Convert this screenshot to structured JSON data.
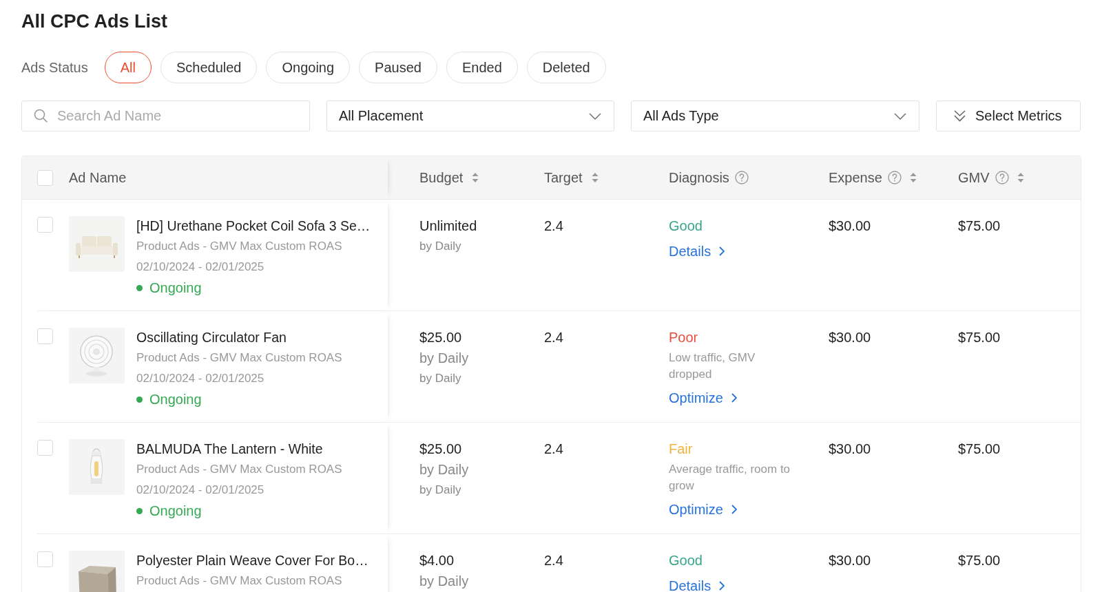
{
  "page": {
    "title": "All CPC Ads List"
  },
  "status_filter": {
    "label": "Ads Status",
    "options": [
      {
        "label": "All",
        "selected": true
      },
      {
        "label": "Scheduled",
        "selected": false
      },
      {
        "label": "Ongoing",
        "selected": false
      },
      {
        "label": "Paused",
        "selected": false
      },
      {
        "label": "Ended",
        "selected": false
      },
      {
        "label": "Deleted",
        "selected": false
      }
    ]
  },
  "filters": {
    "search": {
      "placeholder": "Search Ad Name"
    },
    "placement": {
      "value": "All Placement"
    },
    "ads_type": {
      "value": "All Ads Type"
    },
    "metrics_button": {
      "label": "Select Metrics"
    }
  },
  "table": {
    "select_all": {
      "checked": false
    },
    "columns": [
      {
        "label": "Ad Name",
        "help": false,
        "sortable": false
      },
      {
        "label": "Budget",
        "help": false,
        "sortable": true
      },
      {
        "label": "Target",
        "help": false,
        "sortable": true
      },
      {
        "label": "Diagnosis",
        "help": true,
        "sortable": false
      },
      {
        "label": "Expense",
        "help": true,
        "sortable": true
      },
      {
        "label": "GMV",
        "help": true,
        "sortable": true
      }
    ],
    "rows": [
      {
        "checked": false,
        "name": "[HD] Urethane Pocket Coil Sofa 3 Se…",
        "type": "Product Ads - GMV Max Custom ROAS",
        "dates": "02/10/2024 - 02/01/2025",
        "status": {
          "label": "Ongoing",
          "color": "#34a853"
        },
        "budget": {
          "amount": "Unlimited",
          "note": "by Daily"
        },
        "target": "2.4",
        "diagnosis": {
          "rating": "Good",
          "color": "#35a688",
          "action": "Details"
        },
        "expense": "$30.00",
        "gmv": "$75.00"
      },
      {
        "checked": false,
        "name": "Oscillating Circulator Fan",
        "type": "Product Ads - GMV Max Custom ROAS",
        "dates": "02/10/2024 - 02/01/2025",
        "status": {
          "label": "Ongoing",
          "color": "#34a853"
        },
        "budget": {
          "amount": "$25.00",
          "period": "by Daily",
          "note": "by Daily"
        },
        "target": "2.4",
        "diagnosis": {
          "rating": "Poor",
          "color": "#ea4a3c",
          "description": "Low traffic, GMV dropped",
          "action": "Optimize"
        },
        "expense": "$30.00",
        "gmv": "$75.00"
      },
      {
        "checked": false,
        "name": "BALMUDA The Lantern - White",
        "type": "Product Ads - GMV Max Custom ROAS",
        "dates": "02/10/2024 - 02/01/2025",
        "status": {
          "label": "Ongoing",
          "color": "#34a853"
        },
        "budget": {
          "amount": "$25.00",
          "period": "by Daily",
          "note": "by Daily"
        },
        "target": "2.4",
        "diagnosis": {
          "rating": "Fair",
          "color": "#f2b33d",
          "description": "Average traffic, room to grow",
          "action": "Optimize"
        },
        "expense": "$30.00",
        "gmv": "$75.00"
      },
      {
        "checked": false,
        "name": "Polyester Plain Weave Cover For Bo…",
        "type": "Product Ads - GMV Max Custom ROAS",
        "budget": {
          "amount": "$4.00",
          "period": "by Daily"
        },
        "target": "2.4",
        "diagnosis": {
          "rating": "Good",
          "color": "#35a688",
          "action": "Details"
        },
        "expense": "$30.00",
        "gmv": "$75.00"
      }
    ]
  }
}
